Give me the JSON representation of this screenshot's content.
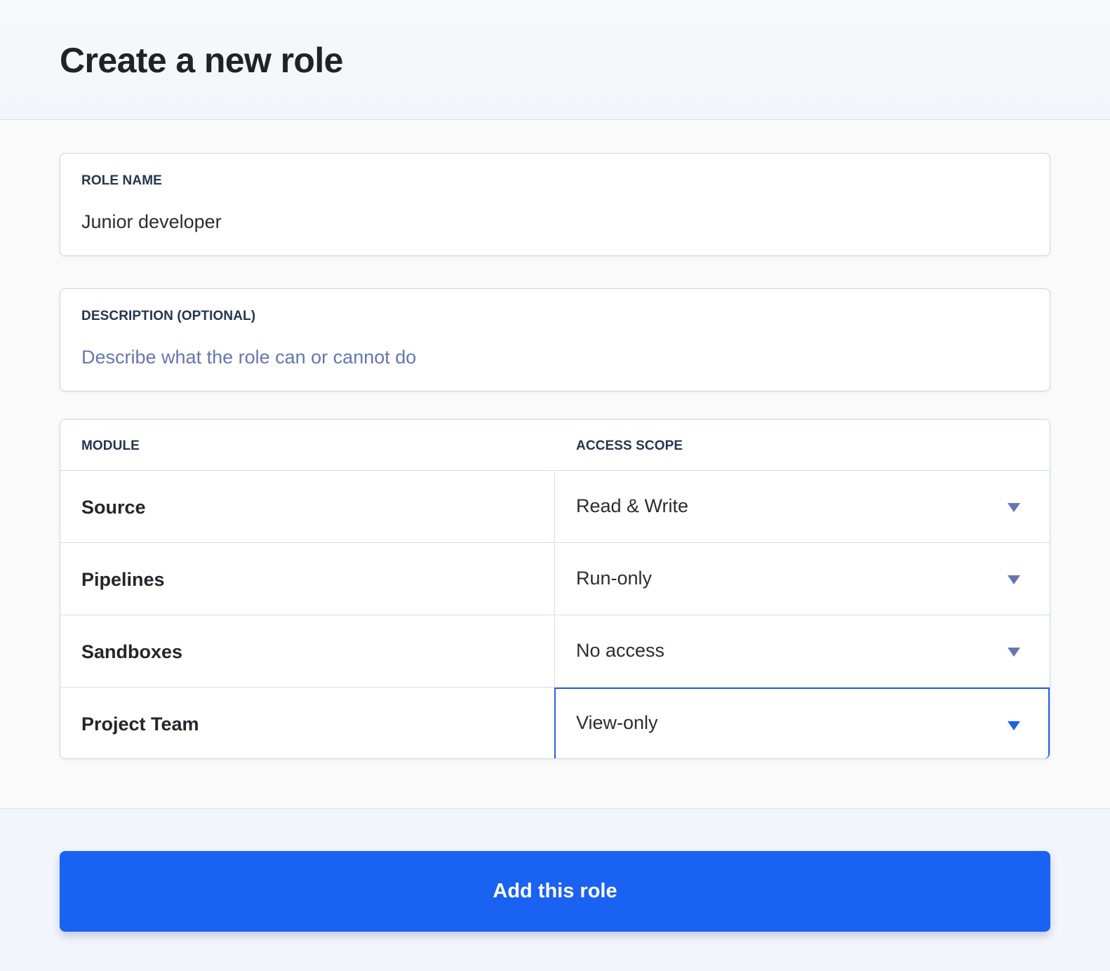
{
  "header": {
    "title": "Create a new role"
  },
  "role_name": {
    "label": "ROLE NAME",
    "value": "Junior developer"
  },
  "description": {
    "label": "DESCRIPTION (OPTIONAL)",
    "placeholder": "Describe what the role can or cannot do",
    "value": ""
  },
  "permissions": {
    "columns": [
      "MODULE",
      "ACCESS SCOPE"
    ],
    "rows": [
      {
        "module": "Source",
        "scope": "Read & Write"
      },
      {
        "module": "Pipelines",
        "scope": "Run-only"
      },
      {
        "module": "Sandboxes",
        "scope": "No access"
      },
      {
        "module": "Project Team",
        "scope": "View-only"
      }
    ],
    "focused_row": "Project Team"
  },
  "footer": {
    "submit_label": "Add this role"
  },
  "colors": {
    "primary": "#1a62f1",
    "focus_border": "#2c62db",
    "label": "#24364f",
    "placeholder": "#6576b2",
    "border": "#c8d4ec"
  },
  "icons": {
    "dropdown": "chevron-down-icon"
  }
}
